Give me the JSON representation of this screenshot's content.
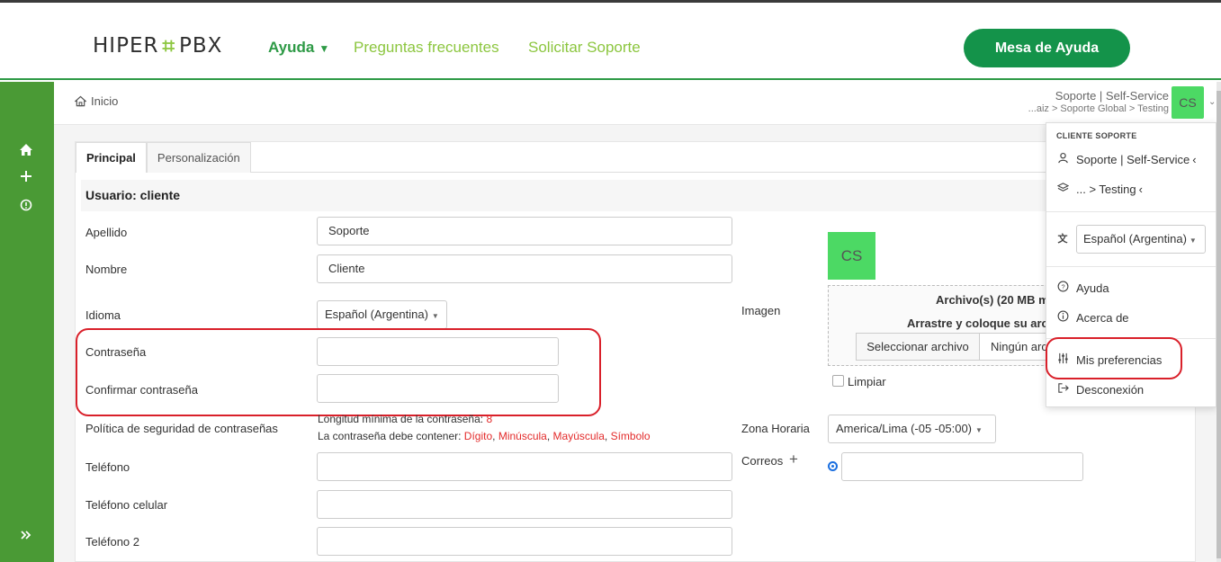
{
  "nav": {
    "logo_left": "HIPER",
    "logo_mark": "⌗",
    "logo_right": "PBX",
    "links": [
      "Ayuda",
      "Preguntas frecuentes",
      "Solicitar Soporte"
    ],
    "ayuda_caret": "▼",
    "cta": "Mesa de Ayuda"
  },
  "sidebar": {
    "icons": [
      "home-icon",
      "plus-icon",
      "info-icon",
      "expand-icon"
    ]
  },
  "header": {
    "breadcrumb": "Inicio",
    "user_name": "Soporte | Self-Service",
    "user_path": "...aiz > Soporte Global > Testing",
    "avatar": "CS"
  },
  "tabs": [
    "Principal",
    "Personalización"
  ],
  "form": {
    "section_title": "Usuario: cliente",
    "apellido_label": "Apellido",
    "apellido_value": "Soporte",
    "nombre_label": "Nombre",
    "nombre_value": "Cliente",
    "idioma_label": "Idioma",
    "idioma_value": "Español (Argentina)",
    "contrasena_label": "Contraseña",
    "confirmar_label": "Confirmar contraseña",
    "politica_label": "Política de seguridad de contraseñas",
    "policy_min_text": "Longitud mínima de la contraseña:",
    "policy_min_value": "8",
    "policy_contain_text": "La contraseña debe contener:",
    "policy_items": [
      "Dígito",
      "Minúscula",
      "Mayúscula",
      "Símbolo"
    ],
    "telefono_label": "Teléfono",
    "celular_label": "Teléfono celular",
    "telefono2_label": "Teléfono 2",
    "imagen_label": "Imagen",
    "avatar_lg": "CS",
    "dz_line1": "Archivo(s) (20 MB m",
    "dz_line2": "Arrastre y coloque su arch",
    "select_file": "Seleccionar archivo",
    "no_file": "Ningún arc",
    "limpiar": "Limpiar",
    "zona_label": "Zona Horaria",
    "zona_value": "America/Lima (-05 -05:00)",
    "correos_label": "Correos",
    "correos_plus": "+"
  },
  "menu": {
    "heading": "CLIENTE SOPORTE",
    "user": "Soporte | Self-Service",
    "org": "... > Testing",
    "chevron": "‹",
    "language": "Español (Argentina)",
    "ayuda": "Ayuda",
    "acerca": "Acerca de",
    "preferencias": "Mis preferencias",
    "desconexion": "Desconexión"
  },
  "colors": {
    "brand_green": "#14934a",
    "lime": "#8cc63f",
    "sidebar": "#4a9a35",
    "avatar": "#4cd964",
    "highlight": "#d9202a"
  }
}
